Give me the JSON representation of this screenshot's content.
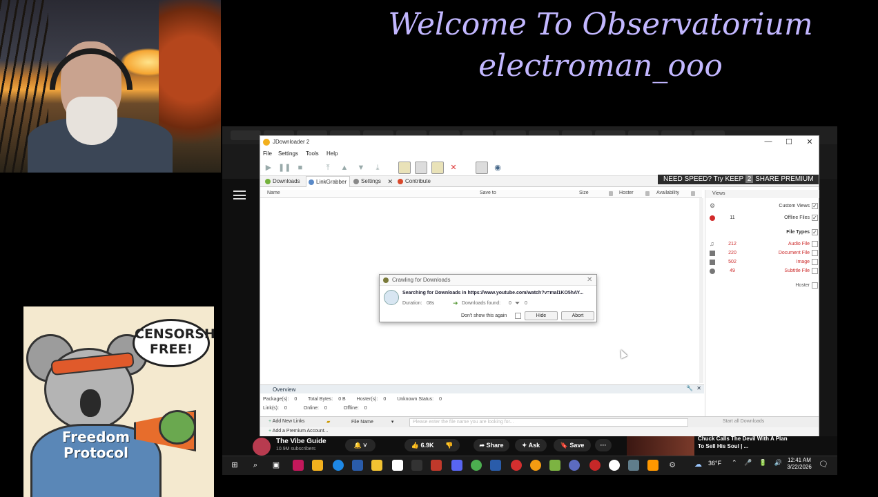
{
  "overlay": {
    "line1": "Welcome To Observatorium",
    "line2": "electroman_ooo"
  },
  "koala": {
    "bubble": "CENSORSHIP FREE!",
    "shirt_line1": "Freedom",
    "shirt_line2": "Protocol"
  },
  "jd": {
    "title": "JDownloader 2",
    "menu": [
      "File",
      "Settings",
      "Tools",
      "Help"
    ],
    "promo_pre": "NEED SPEED? Try KEEP",
    "promo_num": "2",
    "promo_post": "SHARE PREMIUM",
    "tabs": {
      "downloads": "Downloads",
      "linkgrabber": "LinkGrabber",
      "settings": "Settings",
      "contribute": "Contribute"
    },
    "columns": {
      "name": "Name",
      "save_to": "Save to",
      "size": "Size",
      "hoster": "Hoster",
      "availability": "Availability"
    },
    "views": {
      "header": "Views",
      "custom_views": "Custom Views",
      "offline_count": "11",
      "offline_files": "Offline Files",
      "file_types": "File Types",
      "audio_count": "212",
      "audio": "Audio File",
      "document_count": "220",
      "document": "Document File",
      "image_count": "502",
      "image": "Image",
      "subtitle_count": "49",
      "subtitle": "Subtitle File",
      "hoster": "Hoster"
    },
    "overview": {
      "header": "Overview",
      "packages_label": "Package(s):",
      "packages": "0",
      "total_bytes_label": "Total Bytes:",
      "total_bytes": "0 B",
      "hosters_label": "Hoster(s):",
      "hosters": "0",
      "unknown_label": "Unknown Status:",
      "unknown": "0",
      "links_label": "Link(s):",
      "links": "0",
      "online_label": "Online:",
      "online": "0",
      "offline_label": "Offline:",
      "offline": "0"
    },
    "bottom": {
      "add_links": "Add New Links",
      "file_name": "File Name",
      "search_placeholder": "Please enter the file name you are looking for...",
      "start_all": "Start all Downloads",
      "premium": "Add a Premium Account..."
    }
  },
  "dialog": {
    "title": "Crawling for Downloads",
    "message": "Searching for Downloads in https://www.youtube.com/watch?v=mal1KO5hAY...",
    "duration_label": "Duration:",
    "duration": "08s",
    "found_label": "Downloads found:",
    "found": "0",
    "filter_count": "0",
    "dont_show": "Don't show this again",
    "hide": "Hide",
    "abort": "Abort"
  },
  "youtube": {
    "channel": "The Vibe Guide",
    "subscribers": "10.9M subscribers",
    "likes": "6.9K",
    "share": "Share",
    "ask": "Ask",
    "save": "Save",
    "more": "···",
    "next_title": "Chuck Calls The Devil With A Plan To Sell His Soul | ..."
  },
  "taskbar": {
    "temperature": "36°F",
    "time": "12:41 AM",
    "date": "3/22/2026"
  },
  "colors": {
    "overlay_text": "#c2b7ff",
    "offline_red": "#d22a2a",
    "filetype_red": "#cc2a2a"
  }
}
